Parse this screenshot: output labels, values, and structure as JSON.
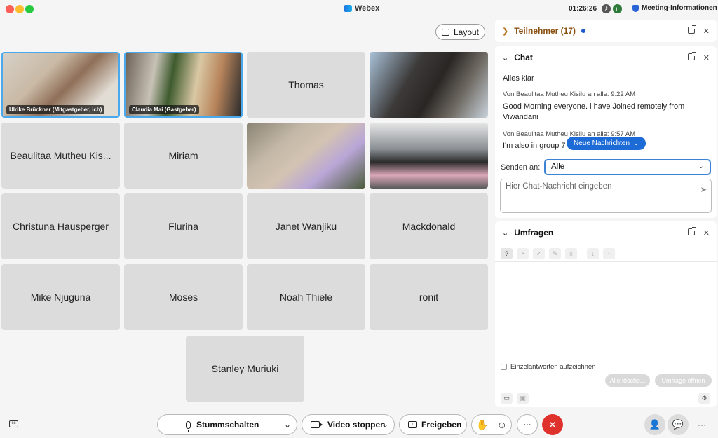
{
  "window": {
    "title": "Webex",
    "clock": "01:26:26",
    "meeting_info": "Meeting-Informationen"
  },
  "toolbar": {
    "layout_label": "Layout"
  },
  "participants_grid": [
    {
      "name": "Ulrike Brückner  (Mitgastgeber, ich)",
      "video": true,
      "active": true
    },
    {
      "name": "Claudia Mai  (Gastgeber)",
      "video": true,
      "active": true
    },
    {
      "name": "Thomas",
      "video": false
    },
    {
      "name": "",
      "video": true
    },
    {
      "name": "Beaulitaa Mutheu Kis...",
      "video": false
    },
    {
      "name": "Miriam",
      "video": false
    },
    {
      "name": "",
      "video": true
    },
    {
      "name": "",
      "video": true
    },
    {
      "name": "Christuna Hausperger",
      "video": false
    },
    {
      "name": "Flurina",
      "video": false
    },
    {
      "name": "Janet Wanjiku",
      "video": false
    },
    {
      "name": "Mackdonald",
      "video": false
    },
    {
      "name": "Mike Njuguna",
      "video": false
    },
    {
      "name": "Moses",
      "video": false
    },
    {
      "name": "Noah Thiele",
      "video": false
    },
    {
      "name": "ronit",
      "video": false
    },
    {
      "name": "Stanley Muriuki",
      "video": false
    }
  ],
  "participants_panel": {
    "title": "Teilnehmer (17)"
  },
  "chat": {
    "title": "Chat",
    "messages": [
      {
        "text": "Alles klar"
      },
      {
        "meta": "Von Beaulitaa Mutheu Kisilu an alle:  9:22  AM",
        "text": "Good Morning everyone. i have Joined remotely from Viwandani"
      },
      {
        "meta": "Von Beaulitaa Mutheu Kisilu an alle:  9:57  AM",
        "text": "I'm also in group 7"
      }
    ],
    "new_messages_label": "Neue Nachrichten",
    "send_to_label": "Senden an:",
    "send_to_value": "Alle",
    "input_placeholder": "Hier Chat-Nachricht eingeben"
  },
  "polls": {
    "title": "Umfragen",
    "record_individual_label": "Einzelantworten aufzeichnen",
    "delete_all_label": "Alle lösche...",
    "open_poll_label": "Umfrage öffnen"
  },
  "controls": {
    "mute_label": "Stummschalten",
    "stop_video_label": "Video stoppen",
    "share_label": "Freigeben",
    "more_label": "···"
  },
  "colors": {
    "accent": "#1d6bd6",
    "end_call": "#e0322c",
    "active_border": "#4aa9ec"
  }
}
